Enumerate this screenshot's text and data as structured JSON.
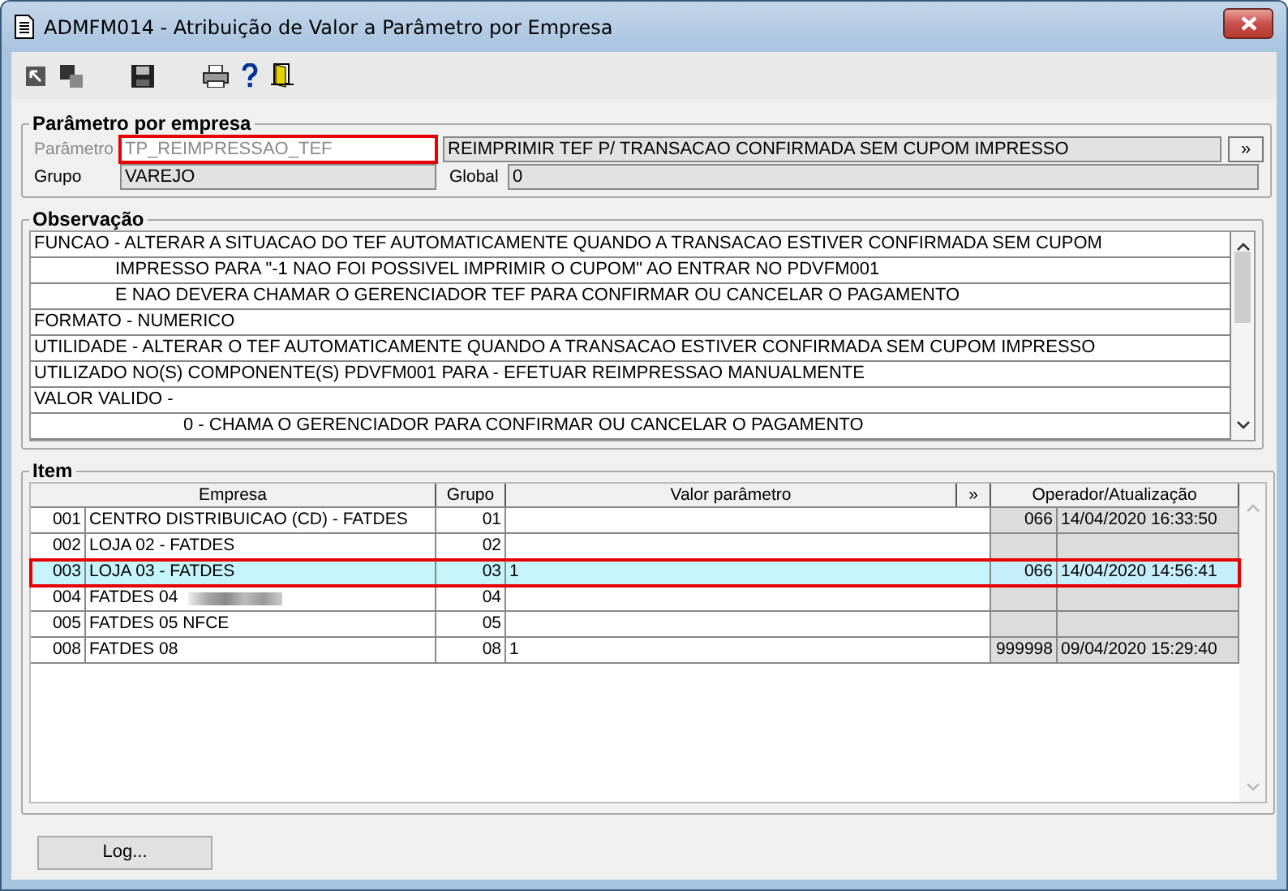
{
  "window": {
    "title": "ADMFM014 - Atribuição de Valor a Parâmetro por Empresa"
  },
  "parametro_group": {
    "title": "Parâmetro por empresa",
    "parametro": {
      "label": "Parâmetro",
      "value": "TP_REIMPRESSAO_TEF",
      "disabled": true,
      "annotated": true
    },
    "descricao": {
      "value": "REIMPRIMIR TEF  P/ TRANSACAO CONFIRMADA SEM CUPOM IMPRESSO"
    },
    "more_button": "»",
    "grupo": {
      "label": "Grupo",
      "value": "VAREJO"
    },
    "global": {
      "label": "Global",
      "value": "0"
    }
  },
  "observacao": {
    "title": "Observação",
    "lines": [
      {
        "kind": "head",
        "text": "FUNCAO - ALTERAR A SITUACAO DO TEF AUTOMATICAMENTE QUANDO A TRANSACAO ESTIVER CONFIRMADA SEM CUPOM"
      },
      {
        "kind": "cont",
        "text": "IMPRESSO PARA \"-1 NAO FOI POSSIVEL IMPRIMIR O CUPOM\" AO ENTRAR NO PDVFM001"
      },
      {
        "kind": "cont",
        "text": "E NAO DEVERA CHAMAR O GERENCIADOR TEF PARA CONFIRMAR OU CANCELAR O PAGAMENTO"
      },
      {
        "kind": "head",
        "text": "FORMATO - NUMERICO"
      },
      {
        "kind": "head",
        "text": "UTILIDADE - ALTERAR O TEF AUTOMATICAMENTE QUANDO A TRANSACAO ESTIVER CONFIRMADA SEM CUPOM IMPRESSO"
      },
      {
        "kind": "head",
        "text": "UTILIZADO NO(S) COMPONENTE(S) PDVFM001 PARA  - EFETUAR REIMPRESSAO MANUALMENTE"
      },
      {
        "kind": "head",
        "text": "VALOR VALIDO -"
      },
      {
        "kind": "value",
        "text": "0 - CHAMA O GERENCIADOR PARA CONFIRMAR OU CANCELAR O PAGAMENTO"
      }
    ]
  },
  "item": {
    "title": "Item",
    "table": {
      "columns": [
        "Empresa",
        "Grupo",
        "Valor parâmetro",
        "»",
        "Operador/Atualização"
      ],
      "rows": [
        {
          "code": "001",
          "empresa": "CENTRO DISTRIBUICAO (CD) - FATDES",
          "grupo": "01",
          "valor": "",
          "operador": "066",
          "atualizacao": "14/04/2020 16:33:50",
          "selected": false,
          "annotated": false
        },
        {
          "code": "002",
          "empresa": "LOJA 02 - FATDES",
          "grupo": "02",
          "valor": "",
          "operador": "",
          "atualizacao": "",
          "selected": false,
          "annotated": false
        },
        {
          "code": "003",
          "empresa": "LOJA 03 - FATDES",
          "grupo": "03",
          "valor": "1",
          "operador": "066",
          "atualizacao": "14/04/2020 14:56:41",
          "selected": true,
          "annotated": true
        },
        {
          "code": "004",
          "empresa": "FATDES 04",
          "grupo": "04",
          "valor": "",
          "operador": "",
          "atualizacao": "",
          "selected": false,
          "annotated": false,
          "redacted": true
        },
        {
          "code": "005",
          "empresa": "FATDES 05 NFCE",
          "grupo": "05",
          "valor": "",
          "operador": "",
          "atualizacao": "",
          "selected": false,
          "annotated": false
        },
        {
          "code": "008",
          "empresa": "FATDES 08",
          "grupo": "08",
          "valor": "1",
          "operador": "999998",
          "atualizacao": "09/04/2020 15:29:40",
          "selected": false,
          "annotated": false
        }
      ]
    }
  },
  "buttons": [
    "Log..."
  ]
}
